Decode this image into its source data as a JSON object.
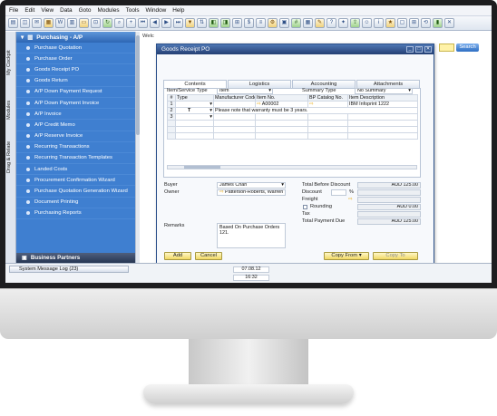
{
  "menu": [
    "File",
    "Edit",
    "View",
    "Data",
    "Goto",
    "Modules",
    "Tools",
    "Window",
    "Help"
  ],
  "workarea": {
    "label": "Welc",
    "search_label": "Search"
  },
  "rail": [
    "My Cockpit",
    "Modules",
    "Drag & Relate"
  ],
  "modules": {
    "section": "Purchasing - A/P",
    "items": [
      "Purchase Quotation",
      "Purchase Order",
      "Goods Receipt PO",
      "Goods Return",
      "A/P Down Payment Request",
      "A/P Down Payment Invoice",
      "A/P Invoice",
      "A/P Credit Memo",
      "A/P Reserve Invoice",
      "Recurring Transactions",
      "Recurring Transaction Templates",
      "Landed Costs",
      "Procurement Confirmation Wizard",
      "Purchase Quotation Generation Wizard",
      "Document Printing",
      "Purchasing Reports"
    ],
    "footer": "Business Partners"
  },
  "window": {
    "title": "Goods Receipt PO",
    "tabs": [
      "Contents",
      "Logistics",
      "Accounting",
      "Attachments"
    ],
    "row_type": {
      "label": "Item/Service Type",
      "value": "Item"
    },
    "summary_type": {
      "label": "Summary Type",
      "value": "No Summary"
    },
    "grid": {
      "headers": [
        "#",
        "Type",
        "Manufacturer Code",
        "Item No.",
        "BP Catalog No.",
        "Item Description"
      ],
      "rows": [
        [
          "1",
          "",
          "",
          "A00002",
          "",
          "IBM Infoprint 1222"
        ],
        [
          "2",
          "T",
          "Please note that warranty must be 3 years.",
          "",
          "",
          ""
        ],
        [
          "3",
          "",
          "",
          "",
          "",
          ""
        ]
      ]
    },
    "buyer": {
      "label": "Buyer",
      "value": "James Chan"
    },
    "owner": {
      "label": "Owner",
      "value": "Patterson-Roberts, Warren"
    },
    "remarks": {
      "label": "Remarks",
      "value": "Based On Purchase Orders 121."
    },
    "totals": {
      "before_discount": {
        "label": "Total Before Discount",
        "value": "AUD 125.00"
      },
      "discount": {
        "label": "Discount",
        "unit": "%"
      },
      "freight": {
        "label": "Freight"
      },
      "rounding": {
        "label": "Rounding",
        "value": "AUD 0.00"
      },
      "tax": {
        "label": "Tax"
      },
      "total": {
        "label": "Total Payment Due",
        "value": "AUD 125.00"
      }
    },
    "buttons": {
      "add": "Add",
      "cancel": "Cancel",
      "copy_from": "Copy From",
      "copy_to": "Copy To"
    }
  },
  "status": {
    "message_log": "System Message Log (23)",
    "date": "07.08.12",
    "time": "16:32"
  }
}
